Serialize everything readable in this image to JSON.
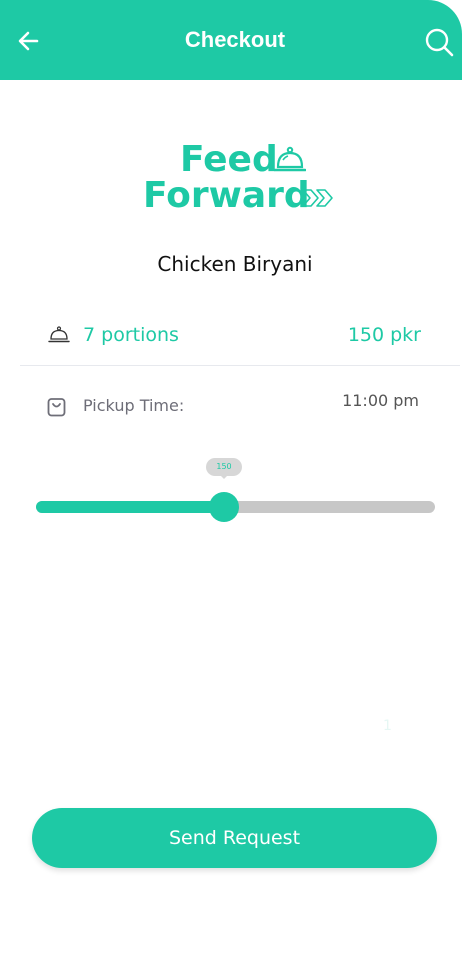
{
  "header": {
    "title": "Checkout",
    "back_icon": "arrow-left-icon",
    "search_icon": "search-icon"
  },
  "logo": {
    "line1": "Feed",
    "line2": "Forward"
  },
  "item": {
    "name": "Chicken Biryani",
    "portions": "7 portions",
    "price": "150 pkr",
    "dish_icon": "cloche-icon"
  },
  "pickup": {
    "label": "Pickup Time:",
    "time": "11:00 pm",
    "icon": "shopping-bag-icon"
  },
  "slider": {
    "value_label": "150",
    "fraction": 0.47
  },
  "page_indicator": "1",
  "actions": {
    "send_request": "Send Request"
  },
  "colors": {
    "accent": "#1ec9a5",
    "track": "#c7c7c7",
    "text_dark": "#111111"
  }
}
